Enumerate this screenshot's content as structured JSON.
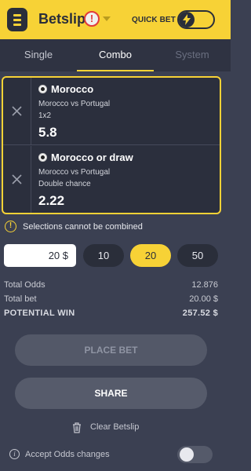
{
  "header": {
    "title": "Betslip",
    "alert_symbol": "!",
    "quick_bet_label": "QUICK BET",
    "quick_bet_enabled": true,
    "accent_color": "#f7d236"
  },
  "tabs": [
    {
      "label": "Single",
      "state": "normal"
    },
    {
      "label": "Combo",
      "state": "active"
    },
    {
      "label": "System",
      "state": "disabled"
    }
  ],
  "selections": [
    {
      "name": "Morocco",
      "match": "Morocco vs Portugal",
      "market": "1x2",
      "odds": "5.8",
      "icon": "soccer-ball-icon"
    },
    {
      "name": "Morocco or draw",
      "match": "Morocco vs Portugal",
      "market": "Double chance",
      "odds": "2.22",
      "icon": "soccer-ball-icon"
    }
  ],
  "warning": {
    "icon": "!",
    "text": "Selections cannot be combined"
  },
  "stake": {
    "value": "20 $",
    "chips": [
      {
        "label": "10",
        "selected": false
      },
      {
        "label": "20",
        "selected": true
      },
      {
        "label": "50",
        "selected": false
      }
    ]
  },
  "summary": {
    "total_odds_label": "Total Odds",
    "total_odds_value": "12.876",
    "total_bet_label": "Total bet",
    "total_bet_value": "20.00 $",
    "potential_win_label": "POTENTIAL WIN",
    "potential_win_value": "257.52 $"
  },
  "buttons": {
    "place_bet": "PLACE BET",
    "share": "SHARE",
    "clear": "Clear Betslip"
  },
  "accept_odds": {
    "label": "Accept Odds changes",
    "enabled": false
  }
}
